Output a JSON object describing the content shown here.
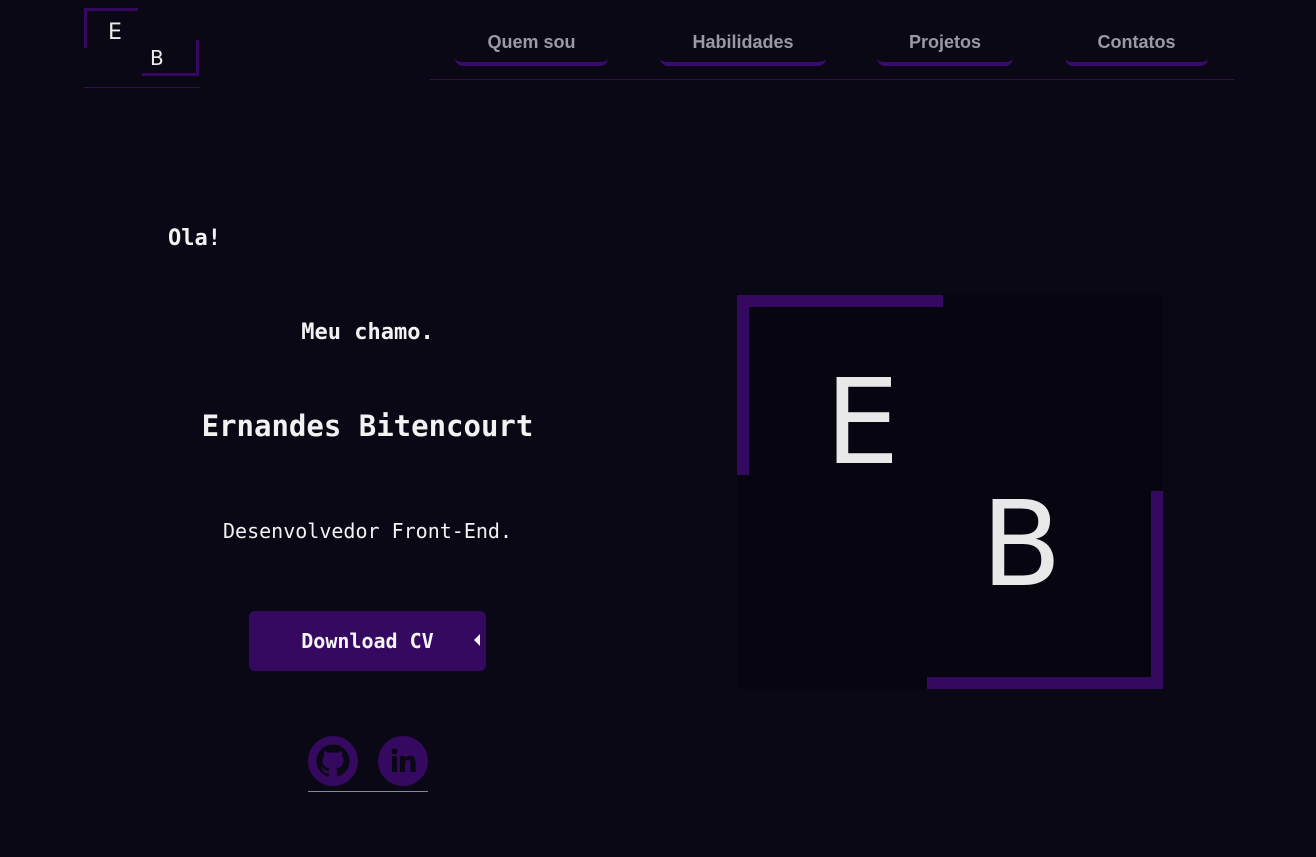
{
  "logo": {
    "letter1": "E",
    "letter2": "B"
  },
  "nav": {
    "items": [
      {
        "label": "Quem sou"
      },
      {
        "label": "Habilidades"
      },
      {
        "label": "Projetos"
      },
      {
        "label": "Contatos"
      }
    ]
  },
  "hero": {
    "greeting": "Ola!",
    "intro": "Meu chamo.",
    "name": "Ernandes Bitencourt",
    "role": "Desenvolvedor Front-End.",
    "cv_button": "Download CV"
  },
  "socials": [
    {
      "icon": "github-icon"
    },
    {
      "icon": "linkedin-icon"
    }
  ],
  "monogram": {
    "letter1": "E",
    "letter2": "B"
  },
  "colors": {
    "background": "#090814",
    "accent": "#35095f",
    "text": "#f2f2f2",
    "nav_text": "#9a99a4"
  }
}
